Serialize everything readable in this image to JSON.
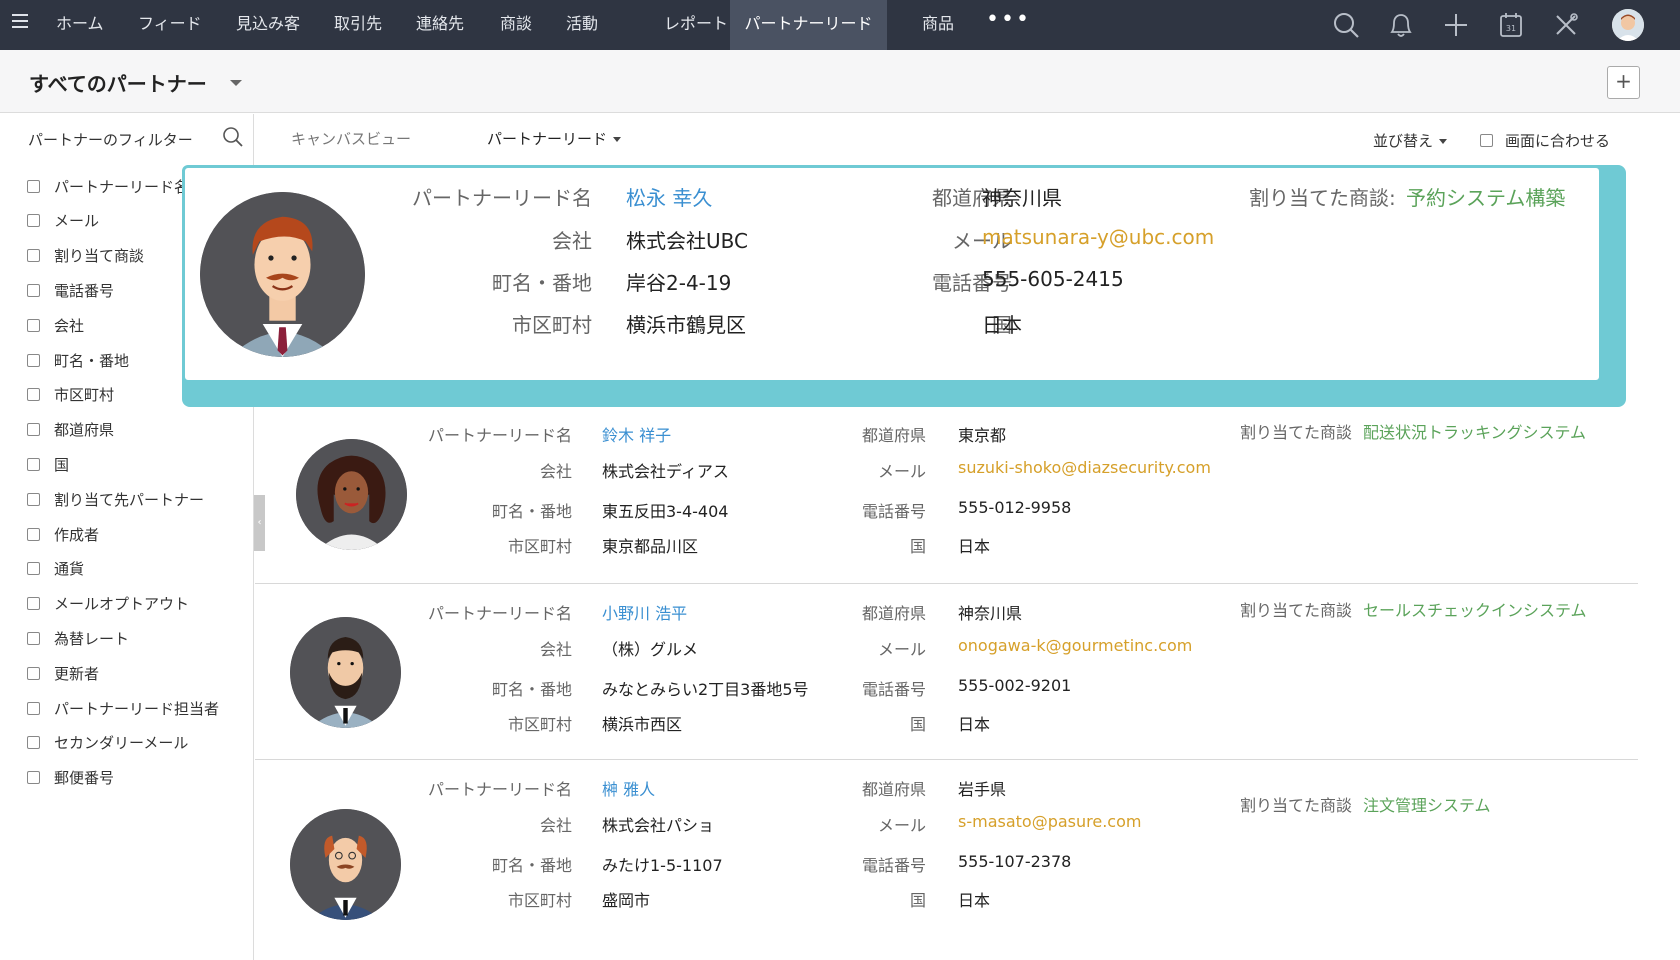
{
  "nav": {
    "items": [
      "ホーム",
      "フィード",
      "見込み客",
      "取引先",
      "連絡先",
      "商談",
      "活動",
      "レポート",
      "パートナーリード",
      "商品"
    ],
    "more": "•••",
    "icons": [
      "search-icon",
      "bell-icon",
      "plus-icon",
      "calendar-icon",
      "tools-icon",
      "user-avatar"
    ],
    "calendar_day": "31"
  },
  "header": {
    "title": "すべてのパートナー",
    "add": "+"
  },
  "sidebar": {
    "title": "パートナーのフィルター",
    "filters": [
      "パートナーリード名",
      "メール",
      "割り当て商談",
      "電話番号",
      "会社",
      "町名・番地",
      "市区町村",
      "都道府県",
      "国",
      "割り当て先パートナー",
      "作成者",
      "通貨",
      "メールオプトアウト",
      "為替レート",
      "更新者",
      "パートナーリード担当者",
      "セカンダリーメール",
      "郵便番号"
    ]
  },
  "toolbar": {
    "canvas_view": "キャンバスビュー",
    "module": "パートナーリード",
    "sort": "並び替え",
    "fit": "画面に合わせる"
  },
  "labels": {
    "name": "パートナーリード名",
    "company": "会社",
    "street": "町名・番地",
    "city": "市区町村",
    "state": "都道府県",
    "email": "メール",
    "phone": "電話番号",
    "country": "国",
    "deal": "割り当てた商談",
    "deal_colon": "割り当てた商談:"
  },
  "records": [
    {
      "name": "松永 幸久",
      "company": "株式会社UBC",
      "street": "岸谷2-4-19",
      "city": "横浜市鶴見区",
      "state": "神奈川県",
      "email": "matsunara-y@ubc.com",
      "phone": "555-605-2415",
      "country": "日本",
      "deal": "予約システム構築"
    },
    {
      "name": "鈴木 祥子",
      "company": "株式会社ディアス",
      "street": "東五反田3-4-404",
      "city": "東京都品川区",
      "state": "東京都",
      "email": "suzuki-shoko@diazsecurity.com",
      "phone": "555-012-9958",
      "country": "日本",
      "deal": "配送状況トラッキングシステム"
    },
    {
      "name": "小野川 浩平",
      "company": "（株）グルメ",
      "street": "みなとみらい2丁目3番地5号",
      "city": "横浜市西区",
      "state": "神奈川県",
      "email": "onogawa-k@gourmetinc.com",
      "phone": "555-002-9201",
      "country": "日本",
      "deal": "セールスチェックインシステム"
    },
    {
      "name": "榊 雅人",
      "company": "株式会社パショ",
      "street": "みたけ1-5-1107",
      "city": "盛岡市",
      "state": "岩手県",
      "email": "s-masato@pasure.com",
      "phone": "555-107-2378",
      "country": "日本",
      "deal": "注文管理システム"
    }
  ],
  "colors": {
    "nav_bg": "#2f3542",
    "card_border": "#6fcad4",
    "link": "#3a8fd1",
    "email": "#d6a02a",
    "deal": "#5ba35a"
  }
}
